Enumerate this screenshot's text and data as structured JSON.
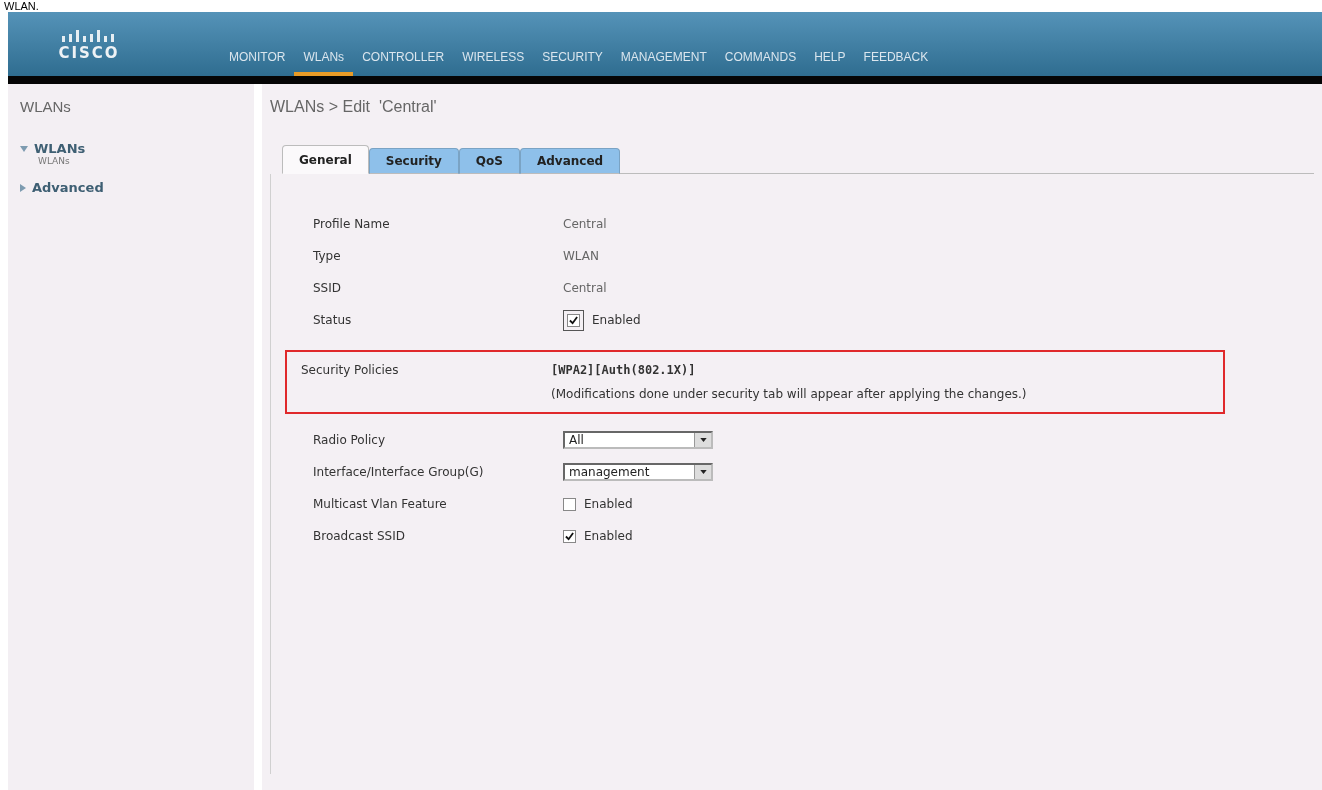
{
  "caption": "WLAN.",
  "header": {
    "logo": "CISCO",
    "nav": [
      {
        "label": "MONITOR",
        "selected": false
      },
      {
        "label": "WLANs",
        "selected": true
      },
      {
        "label": "CONTROLLER",
        "selected": false
      },
      {
        "label": "WIRELESS",
        "selected": false
      },
      {
        "label": "SECURITY",
        "selected": false
      },
      {
        "label": "MANAGEMENT",
        "selected": false
      },
      {
        "label": "COMMANDS",
        "selected": false
      },
      {
        "label": "HELP",
        "selected": false
      },
      {
        "label": "FEEDBACK",
        "selected": false
      }
    ]
  },
  "sidebar": {
    "title": "WLANs",
    "items": [
      {
        "label": "WLANs",
        "expanded": true,
        "children": [
          {
            "label": "WLANs"
          }
        ]
      },
      {
        "label": "Advanced",
        "expanded": false
      }
    ]
  },
  "breadcrumb": "WLANs > Edit  'Central'",
  "tabs": [
    {
      "label": "General",
      "selected": true
    },
    {
      "label": "Security",
      "selected": false
    },
    {
      "label": "QoS",
      "selected": false
    },
    {
      "label": "Advanced",
      "selected": false
    }
  ],
  "fields": [
    {
      "kind": "text",
      "label": "Profile Name",
      "value": "Central"
    },
    {
      "kind": "text",
      "label": "Type",
      "value": "WLAN"
    },
    {
      "kind": "text",
      "label": "SSID",
      "value": "Central"
    },
    {
      "kind": "checkbox",
      "label": "Status",
      "checked": true,
      "value": "Enabled"
    }
  ],
  "security_policies": {
    "label": "Security Policies",
    "value": "[WPA2][Auth(802.1X)]",
    "note": "(Modifications done under security tab will appear after applying the changes.)"
  },
  "options": [
    {
      "kind": "select",
      "label": "Radio Policy",
      "value": "All"
    },
    {
      "kind": "select",
      "label": "Interface/Interface Group(G)",
      "value": "management"
    },
    {
      "kind": "checkbox",
      "label": "Multicast Vlan Feature",
      "checked": false,
      "value": "Enabled"
    },
    {
      "kind": "checkbox",
      "label": "Broadcast SSID",
      "checked": true,
      "value": "Enabled"
    }
  ]
}
